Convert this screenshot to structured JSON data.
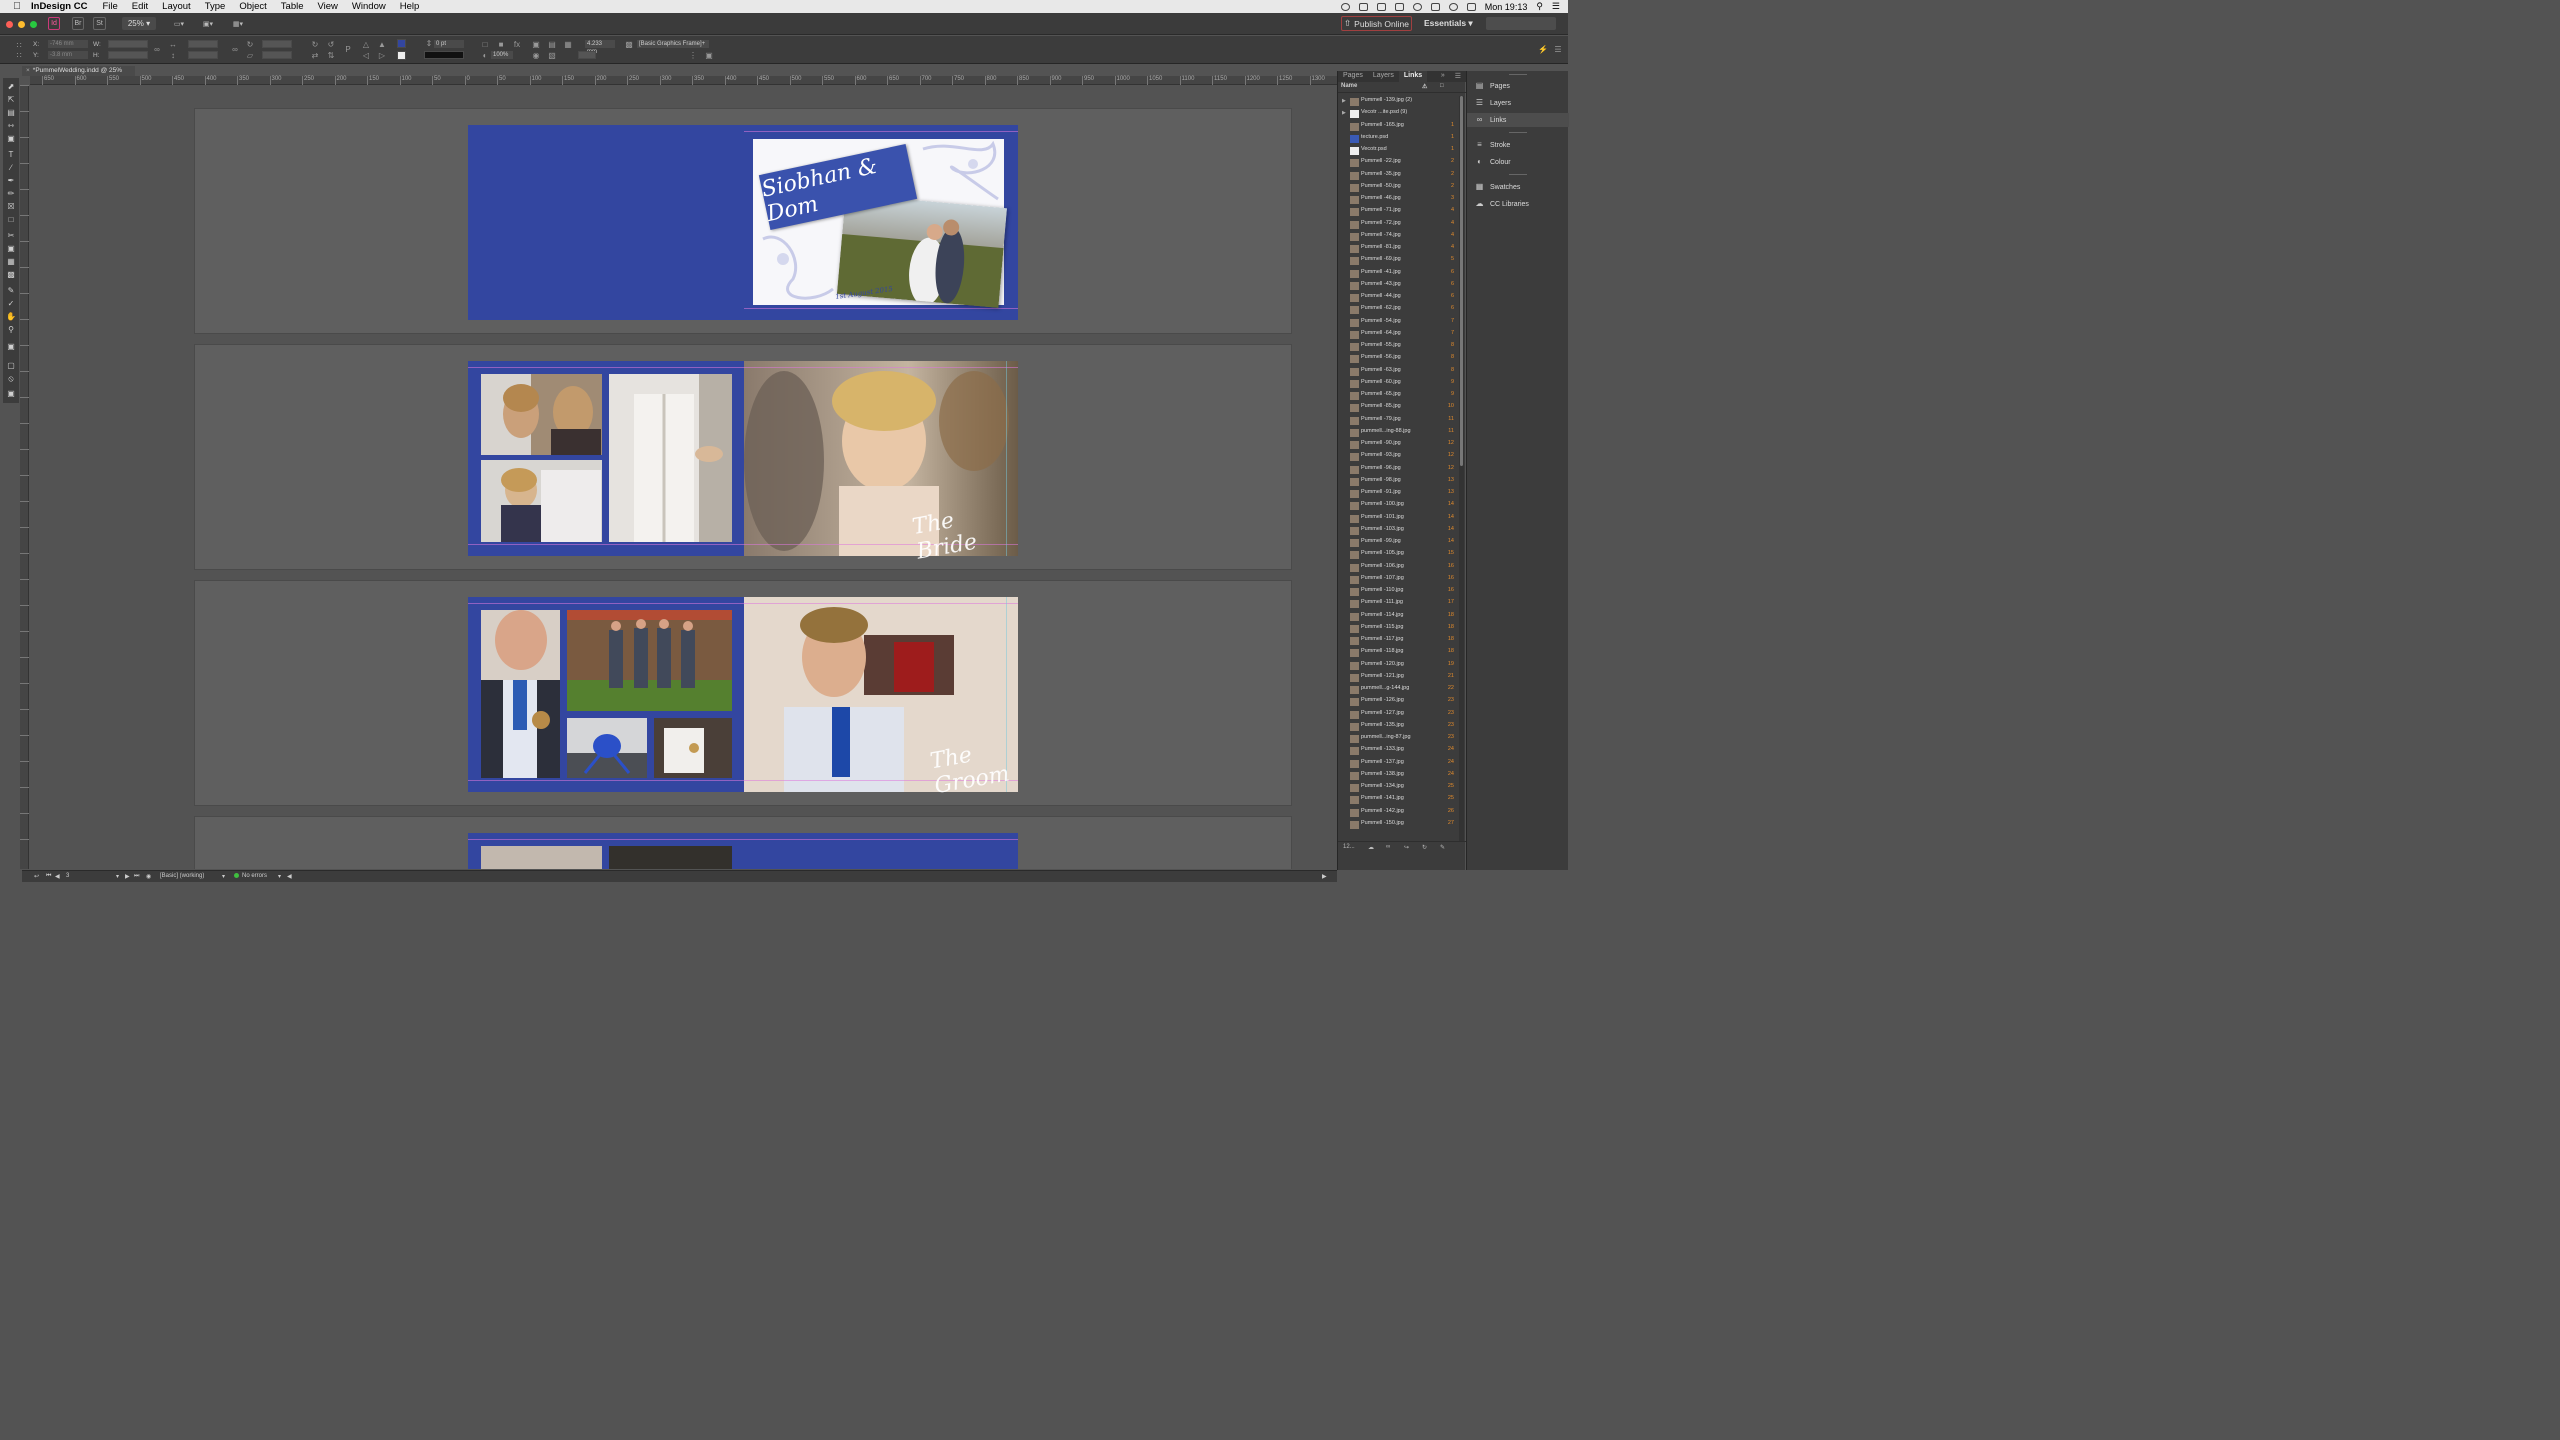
{
  "menubar": {
    "app_name": "InDesign CC",
    "items": [
      "File",
      "Edit",
      "Layout",
      "Type",
      "Object",
      "Table",
      "View",
      "Window",
      "Help"
    ],
    "clock": "Mon 19:13"
  },
  "appbar": {
    "zoom": "25%",
    "publish_label": "Publish Online",
    "workspace": "Essentials"
  },
  "control_panel": {
    "x_label": "X:",
    "y_label": "Y:",
    "w_label": "W:",
    "h_label": "H:",
    "x_value": "-746 mm",
    "y_value": "-3.8 mm",
    "stroke_weight": "0 pt",
    "opacity": "100%",
    "width_value": "4.233 mm",
    "object_style": "[Basic Graphics Frame]+"
  },
  "document": {
    "tab_title": "*PummelWedding.indd @ 25%",
    "ruler_ticks": [
      "650",
      "600",
      "550",
      "500",
      "450",
      "400",
      "350",
      "300",
      "250",
      "200",
      "150",
      "100",
      "50",
      "0",
      "50",
      "100",
      "150",
      "200",
      "250",
      "300",
      "350",
      "400",
      "450",
      "500",
      "550",
      "600",
      "650",
      "700",
      "750",
      "800",
      "850",
      "900",
      "950",
      "1000",
      "1050",
      "1100",
      "1150",
      "1200",
      "1250",
      "1300"
    ],
    "cover_title": "Siobhan & Dom",
    "cover_date": "1st August 2015",
    "bride_label": "The Bride",
    "groom_label": "The Groom"
  },
  "links_panel": {
    "tabs": [
      "Pages",
      "Layers",
      "Links"
    ],
    "active_tab": "Links",
    "column_name": "Name",
    "footer_count": "12...",
    "rows": [
      {
        "name": "Pummell -139.jpg (2)",
        "page": "",
        "thumb": "photo",
        "arrow": true
      },
      {
        "name": "Vecotr ...ite.psd (9)",
        "page": "",
        "thumb": "white",
        "arrow": true
      },
      {
        "name": "Pummell -165.jpg",
        "page": "1",
        "thumb": "photo"
      },
      {
        "name": "tecture.psd",
        "page": "1",
        "thumb": "bluet"
      },
      {
        "name": "Vecotr.psd",
        "page": "1",
        "thumb": "white"
      },
      {
        "name": "Pummell -22.jpg",
        "page": "2",
        "thumb": "photo"
      },
      {
        "name": "Pummell -35.jpg",
        "page": "2",
        "thumb": "photo"
      },
      {
        "name": "Pummell -50.jpg",
        "page": "2",
        "thumb": "photo"
      },
      {
        "name": "Pummell -46.jpg",
        "page": "3",
        "thumb": "photo"
      },
      {
        "name": "Pummell -71.jpg",
        "page": "4",
        "thumb": "photo"
      },
      {
        "name": "Pummell -72.jpg",
        "page": "4",
        "thumb": "photo"
      },
      {
        "name": "Pummell -74.jpg",
        "page": "4",
        "thumb": "photo"
      },
      {
        "name": "Pummell -81.jpg",
        "page": "4",
        "thumb": "photo"
      },
      {
        "name": "Pummell -69.jpg",
        "page": "5",
        "thumb": "photo"
      },
      {
        "name": "Pummell -41.jpg",
        "page": "6",
        "thumb": "photo"
      },
      {
        "name": "Pummell -43.jpg",
        "page": "6",
        "thumb": "photo"
      },
      {
        "name": "Pummell -44.jpg",
        "page": "6",
        "thumb": "photo"
      },
      {
        "name": "Pummell -62.jpg",
        "page": "6",
        "thumb": "photo"
      },
      {
        "name": "Pummell -54.jpg",
        "page": "7",
        "thumb": "photo"
      },
      {
        "name": "Pummell -64.jpg",
        "page": "7",
        "thumb": "photo"
      },
      {
        "name": "Pummell -55.jpg",
        "page": "8",
        "thumb": "photo"
      },
      {
        "name": "Pummell -56.jpg",
        "page": "8",
        "thumb": "photo"
      },
      {
        "name": "Pummell -63.jpg",
        "page": "8",
        "thumb": "photo"
      },
      {
        "name": "Pummell -60.jpg",
        "page": "9",
        "thumb": "photo"
      },
      {
        "name": "Pummell -65.jpg",
        "page": "9",
        "thumb": "photo"
      },
      {
        "name": "Pummell -85.jpg",
        "page": "10",
        "thumb": "photo"
      },
      {
        "name": "Pummell -79.jpg",
        "page": "11",
        "thumb": "photo"
      },
      {
        "name": "pummell...ing-88.jpg",
        "page": "11",
        "thumb": "photo"
      },
      {
        "name": "Pummell -90.jpg",
        "page": "12",
        "thumb": "photo"
      },
      {
        "name": "Pummell -93.jpg",
        "page": "12",
        "thumb": "photo"
      },
      {
        "name": "Pummell -96.jpg",
        "page": "12",
        "thumb": "photo"
      },
      {
        "name": "Pummell -98.jpg",
        "page": "13",
        "thumb": "photo"
      },
      {
        "name": "Pummell -91.jpg",
        "page": "13",
        "thumb": "photo"
      },
      {
        "name": "Pummell -100.jpg",
        "page": "14",
        "thumb": "photo"
      },
      {
        "name": "Pummell -101.jpg",
        "page": "14",
        "thumb": "photo"
      },
      {
        "name": "Pummell -103.jpg",
        "page": "14",
        "thumb": "photo"
      },
      {
        "name": "Pummell -99.jpg",
        "page": "14",
        "thumb": "photo"
      },
      {
        "name": "Pummell -105.jpg",
        "page": "15",
        "thumb": "photo"
      },
      {
        "name": "Pummell -106.jpg",
        "page": "16",
        "thumb": "photo"
      },
      {
        "name": "Pummell -107.jpg",
        "page": "16",
        "thumb": "photo"
      },
      {
        "name": "Pummell -110.jpg",
        "page": "16",
        "thumb": "photo"
      },
      {
        "name": "Pummell -111.jpg",
        "page": "17",
        "thumb": "photo"
      },
      {
        "name": "Pummell -114.jpg",
        "page": "18",
        "thumb": "photo"
      },
      {
        "name": "Pummell -115.jpg",
        "page": "18",
        "thumb": "photo"
      },
      {
        "name": "Pummell -117.jpg",
        "page": "18",
        "thumb": "photo"
      },
      {
        "name": "Pummell -118.jpg",
        "page": "18",
        "thumb": "photo"
      },
      {
        "name": "Pummell -120.jpg",
        "page": "19",
        "thumb": "photo"
      },
      {
        "name": "Pummell -121.jpg",
        "page": "21",
        "thumb": "photo"
      },
      {
        "name": "pummell...g-144.jpg",
        "page": "22",
        "thumb": "photo"
      },
      {
        "name": "Pummell -126.jpg",
        "page": "23",
        "thumb": "photo"
      },
      {
        "name": "Pummell -127.jpg",
        "page": "23",
        "thumb": "photo"
      },
      {
        "name": "Pummell -135.jpg",
        "page": "23",
        "thumb": "photo"
      },
      {
        "name": "pummell...ing-87.jpg",
        "page": "23",
        "thumb": "photo"
      },
      {
        "name": "Pummell -133.jpg",
        "page": "24",
        "thumb": "photo"
      },
      {
        "name": "Pummell -137.jpg",
        "page": "24",
        "thumb": "photo"
      },
      {
        "name": "Pummell -138.jpg",
        "page": "24",
        "thumb": "photo"
      },
      {
        "name": "Pummell -134.jpg",
        "page": "25",
        "thumb": "photo"
      },
      {
        "name": "Pummell -141.jpg",
        "page": "25",
        "thumb": "photo"
      },
      {
        "name": "Pummell -142.jpg",
        "page": "26",
        "thumb": "photo"
      },
      {
        "name": "Pummell -150.jpg",
        "page": "27",
        "thumb": "photo"
      }
    ]
  },
  "dock": {
    "items": [
      {
        "label": "Pages",
        "icon": "pages-icon"
      },
      {
        "label": "Layers",
        "icon": "layers-icon"
      },
      {
        "label": "Links",
        "icon": "links-icon"
      },
      {
        "label": "Stroke",
        "icon": "stroke-icon"
      },
      {
        "label": "Colour",
        "icon": "colour-icon"
      },
      {
        "label": "Swatches",
        "icon": "swatches-icon"
      },
      {
        "label": "CC Libraries",
        "icon": "cc-libraries-icon"
      }
    ]
  },
  "statusbar": {
    "page_number": "3",
    "preflight_profile": "[Basic] (working)",
    "preflight_status": "No errors"
  },
  "colors": {
    "page_blue": "#3346a0",
    "link_page_number": "#e08a2c"
  }
}
